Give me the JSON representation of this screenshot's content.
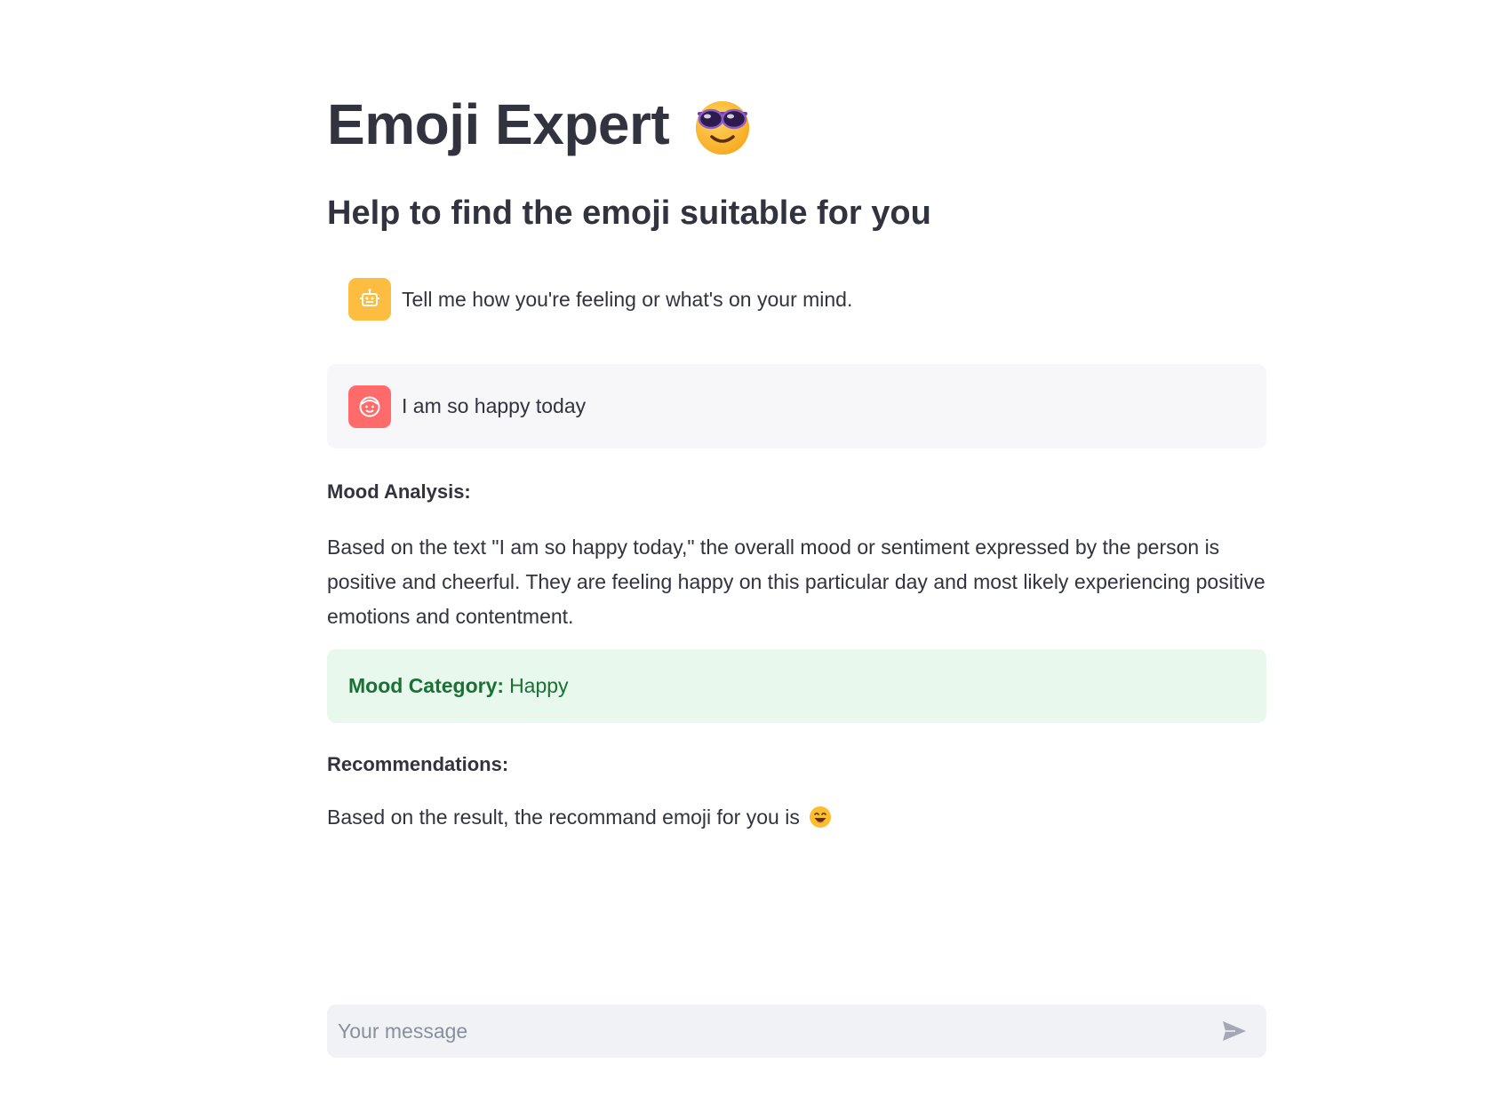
{
  "header": {
    "title": "Emoji Expert",
    "title_emoji": "smiling-face-with-sunglasses-icon",
    "subtitle": "Help to find the emoji suitable for you"
  },
  "chat": {
    "messages": [
      {
        "role": "assistant",
        "avatar": "robot-icon",
        "text": "Tell me how you're feeling or what's on your mind."
      },
      {
        "role": "user",
        "avatar": "user-face-icon",
        "text": "I am so happy today"
      }
    ]
  },
  "response": {
    "mood_analysis_heading": "Mood Analysis:",
    "mood_analysis_text": "Based on the text \"I am so happy today,\" the overall mood or sentiment expressed by the person is positive and cheerful. They are feeling happy on this particular day and most likely experiencing positive emotions and contentment.",
    "mood_category_label": "Mood Category:",
    "mood_category_value": "Happy",
    "recommendations_heading": "Recommendations:",
    "recommendation_text": "Based on the result, the recommand emoji for you is",
    "recommendation_emoji": "grinning-face-with-smiling-eyes-icon"
  },
  "input": {
    "placeholder": "Your message",
    "send_icon": "send-icon"
  },
  "colors": {
    "text": "#31333f",
    "bot_avatar": "#fdbd40",
    "user_avatar": "#ff6b6b",
    "user_bubble": "#f7f7f9",
    "success_bg": "#e8f8ec",
    "success_text": "#177233",
    "input_bg": "#f0f2f6"
  }
}
